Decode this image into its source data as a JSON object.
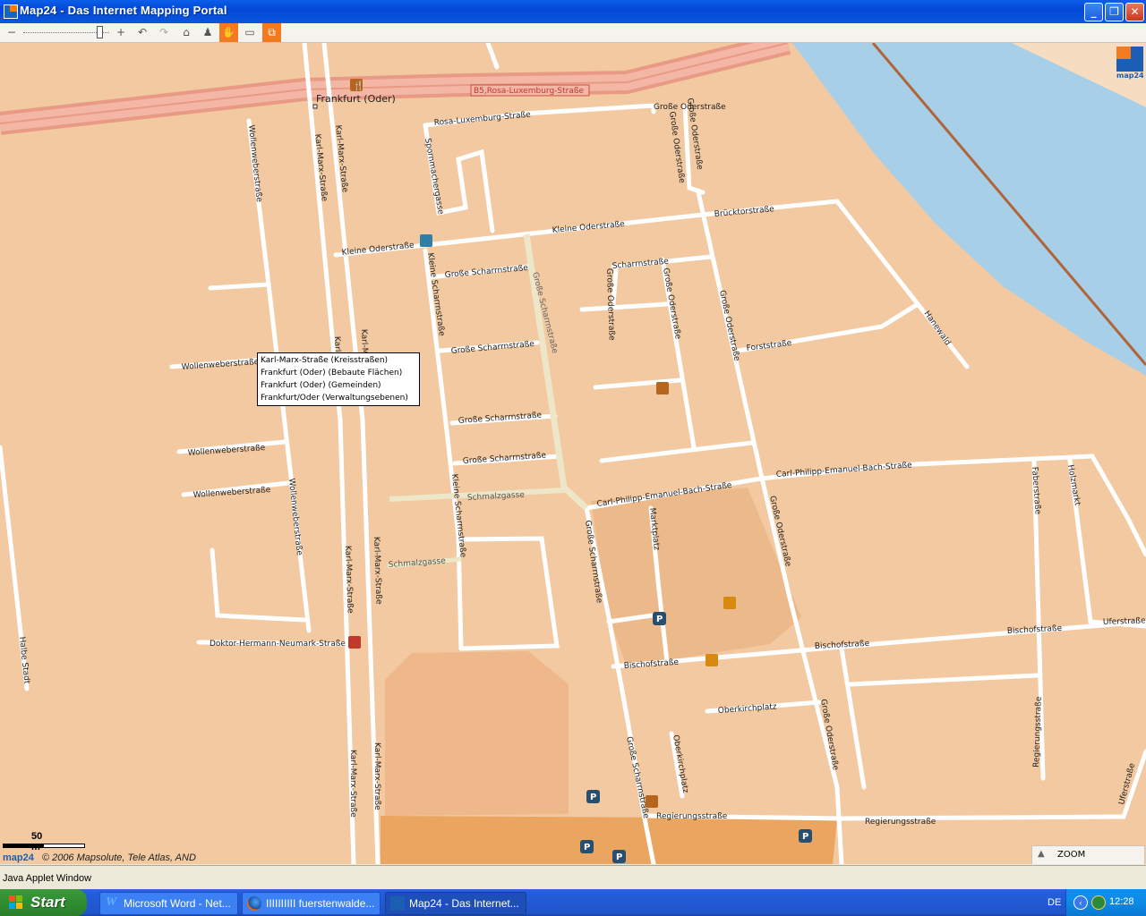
{
  "window": {
    "title": "Map24 - Das Internet Mapping Portal"
  },
  "toolbar": {
    "zoom_out": "−",
    "zoom_in": "+",
    "zoom_level": 0.85
  },
  "map": {
    "street_labels": {
      "b5": "B5,Rosa-Luxemburg-Straße",
      "rosa": "Rosa-Luxemburg-Straße",
      "spornmacher": "Spornmachergasse",
      "kleine_oder1": "Kleine Oderstraße",
      "kleine_oder2": "Kleine Oderstraße",
      "brueckentor": "Brücktorstraße",
      "scharrnstr_small": "Scharrnstraße",
      "grosse_scharrn1": "Große Scharrnstraße",
      "grosse_scharrn2": "Große Scharrnstraße",
      "grosse_scharrn3": "Große Scharrnstraße",
      "grosse_scharrn4": "Große Scharrnstraße",
      "grosse_scharrn_v": "Große Scharrnstraße",
      "grosse_scharrn_v2": "Große Scharrnstraße",
      "grosse_scharrn_v3": "Große Scharrnstraße",
      "kleine_scharrn1": "Kleine Scharrnstraße",
      "kleine_scharrn2": "Kleine Scharrnstraße",
      "grosse_oder1": "Große Oderstraße",
      "grosse_oder2": "Große Oderstraße",
      "grosse_oder3": "Große Oderstraße",
      "grosse_oder4": "Große Oderstraße",
      "grosse_oder5": "Große Oderstraße",
      "grosse_oder6": "Große Oderstraße",
      "forst": "Forststraße",
      "hanewald": "Hanewald",
      "karl_marx1": "Karl-Marx-Straße",
      "karl_marx2": "Karl-Marx-Straße",
      "karl_marx3": "Karl-Marx-Straße",
      "karl_marx4": "Karl-Marx-Straße",
      "karl_marx5": "Karl-Marx-Straße",
      "karl_marx6": "Karl-Marx-Straße",
      "karl_marx7": "Karl-M",
      "karl_marx8": "Karl-",
      "wollen1": "Wollenweberstraße",
      "wollen2": "Wollenweberstraße",
      "wollen3": "Wollenweberstraße",
      "wollen4": "Wollenweberstraße",
      "wollen5": "Wollenweberstraße",
      "schmalz1": "Schmalzgasse",
      "schmalz2": "Schmalzgasse",
      "cpeb1": "Carl-Philipp-Emanuel-Bach-Straße",
      "cpeb2": "Carl-Philipp-Emanuel-Bach-Straße",
      "marktplatz": "Marktplatz",
      "faber": "Faberstraße",
      "holzmarkt": "Holzmarkt",
      "ufer1": "Uferstraße",
      "ufer2": "Uferstraße",
      "bischof1": "Bischofstraße",
      "bischof2": "Bischofstraße",
      "bischof3": "Bischofstraße",
      "oberkirch1": "Oberkirchplatz",
      "oberkirch2": "Oberkirchplatz",
      "regierung1": "Regierungsstraße",
      "regierung2": "Regierungsstraße",
      "regierung3": "Regierungsstraße",
      "doktor": "Doktor-Hermann-Neumark-Straße",
      "halbe": "Halbe Stadt",
      "frankfurt": "Frankfurt (Oder)",
      "grosse_oder_top": "Große Oderstraße",
      "grosse_top": "Große Oderstraße"
    },
    "tooltip": [
      "Karl-Marx-Straße (Kreisstraßen)",
      "Frankfurt (Oder) (Bebaute Flächen)",
      "Frankfurt (Oder) (Gemeinden)",
      "Frankfurt/Oder (Verwaltungsebenen)"
    ],
    "scale": "50 m",
    "copyright_logo": "map24",
    "copyright": "© 2006 Mapsolute, Tele Atlas, AND",
    "logo_text": "map24",
    "zoom_label": "ZOOM",
    "colors": {
      "land": "#f2c9a0",
      "river": "#a8cfe8",
      "road": "#ffffff",
      "highway": "#eea08a",
      "pedestrian": "#ede6c8",
      "accent": "#f47a1f"
    }
  },
  "applet_status": "Java Applet Window",
  "taskbar": {
    "start": "Start",
    "tasks": [
      "Microsoft Word - Net...",
      "IIIIIIIIII fuerstenwalde...",
      "Map24 - Das Internet..."
    ],
    "lang": "DE",
    "clock": "12:28"
  }
}
